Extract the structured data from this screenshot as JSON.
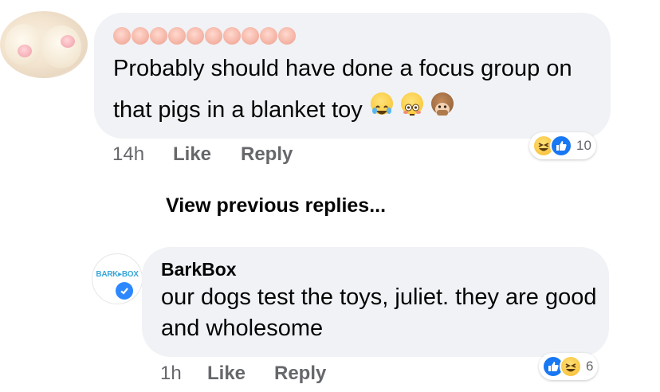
{
  "comment_1": {
    "author_label": "",
    "text": "Probably should have done a focus group on that pigs in a blanket toy",
    "emojis": [
      "face-with-tears-of-joy",
      "flushed-face",
      "speak-no-evil-monkey"
    ],
    "time": "14h",
    "like_label": "Like",
    "reply_label": "Reply",
    "reactions": {
      "icons": [
        "haha",
        "like"
      ],
      "count": "10"
    }
  },
  "view_previous": "View previous replies...",
  "comment_2": {
    "author": "BarkBox",
    "avatar_text": "BARK▸BOX",
    "text": "our dogs test the toys, juliet. they are good and wholesome",
    "time": "1h",
    "like_label": "Like",
    "reply_label": "Reply",
    "reactions": {
      "icons": [
        "like",
        "haha"
      ],
      "count": "6"
    }
  },
  "colors": {
    "bubble": "#f0f2f5",
    "meta_text": "#65676b",
    "like_blue": "#1877f2",
    "verified_blue": "#2d88ff"
  }
}
